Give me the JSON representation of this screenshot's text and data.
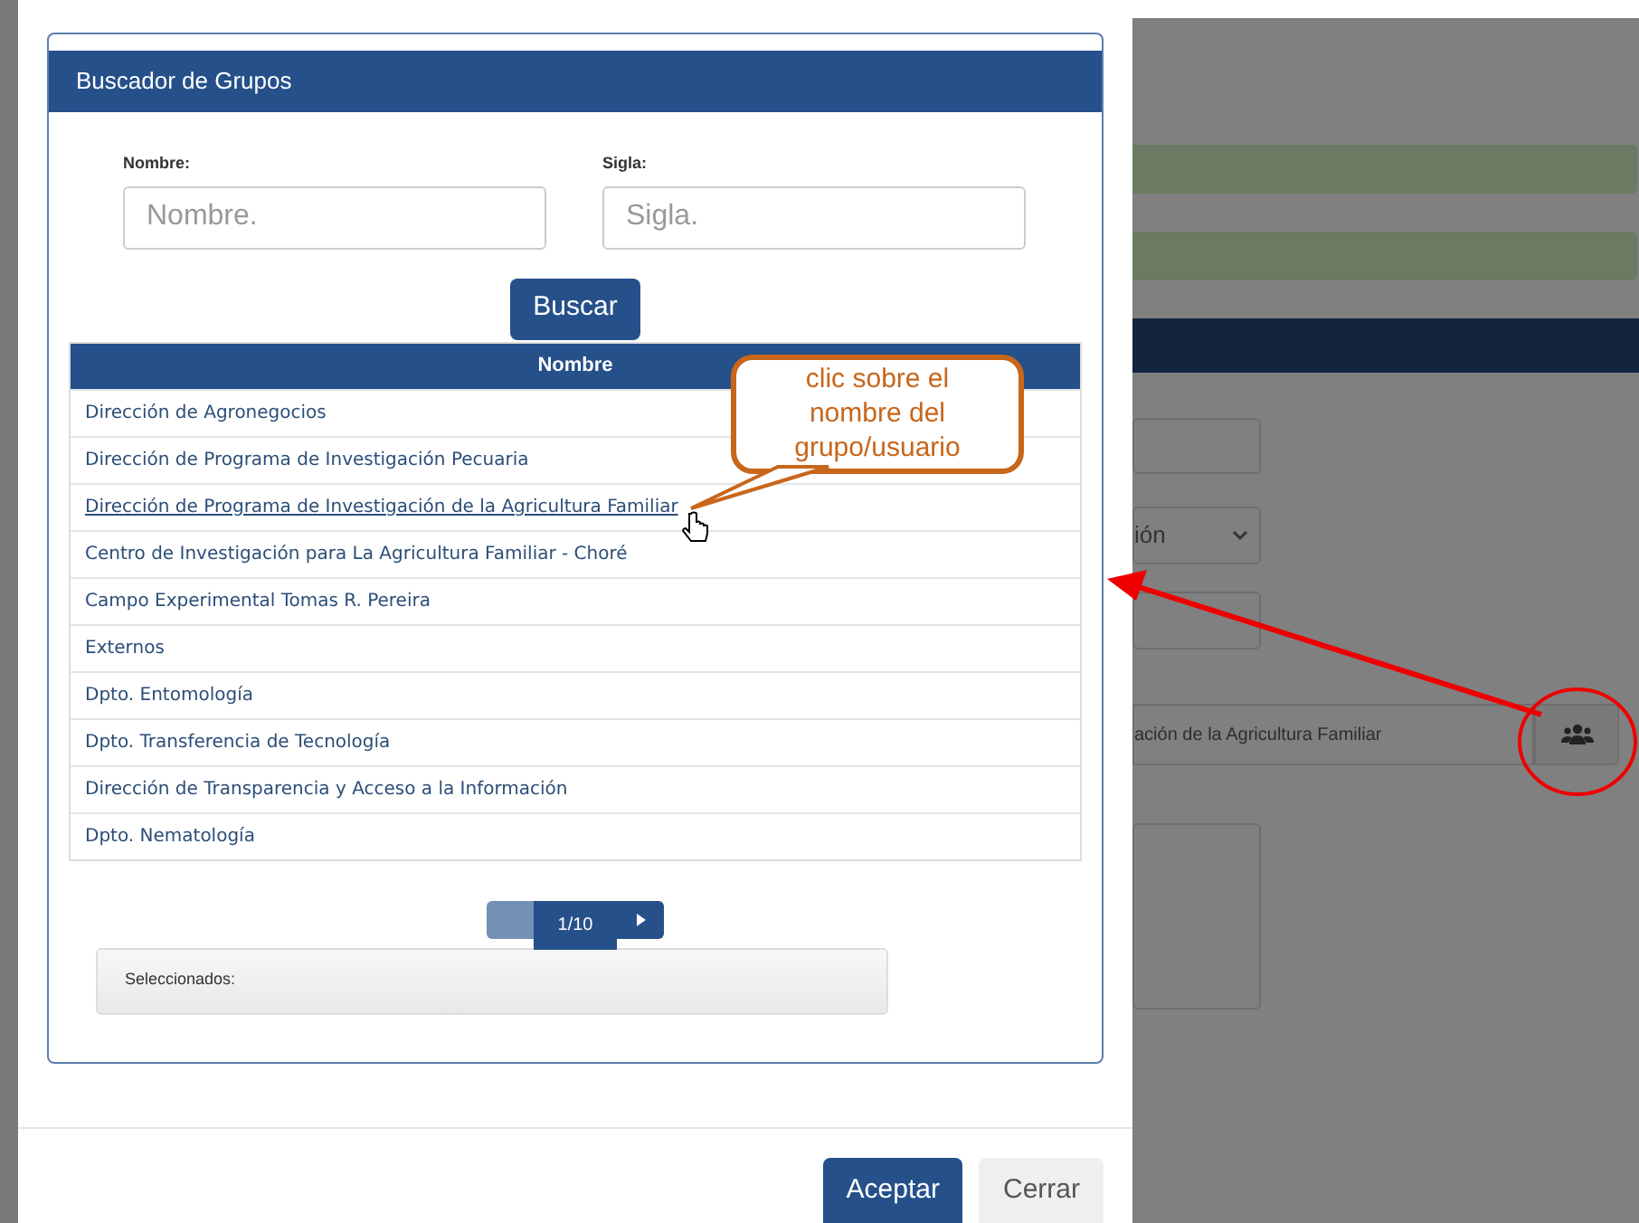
{
  "dialog": {
    "title": "Buscador de Grupos",
    "fields": [
      {
        "label": "Nombre:",
        "placeholder": "Nombre."
      },
      {
        "label": "Sigla:",
        "placeholder": "Sigla."
      }
    ],
    "search_button": "Buscar",
    "table": {
      "columns": [
        "Nombre"
      ],
      "rows": [
        {
          "name": "Dirección de Agronegocios",
          "hovered": false
        },
        {
          "name": "Dirección de Programa de Investigación Pecuaria",
          "hovered": false
        },
        {
          "name": "Dirección de Programa de Investigación de la Agricultura Familiar",
          "hovered": true
        },
        {
          "name": "Centro de Investigación para La Agricultura Familiar - Choré",
          "hovered": false
        },
        {
          "name": "Campo Experimental Tomas R. Pereira",
          "hovered": false
        },
        {
          "name": "Externos",
          "hovered": false
        },
        {
          "name": "Dpto. Entomología",
          "hovered": false
        },
        {
          "name": "Dpto. Transferencia de Tecnología",
          "hovered": false
        },
        {
          "name": "Dirección de Transparencia y Acceso a la Información",
          "hovered": false
        },
        {
          "name": "Dpto. Nematología",
          "hovered": false
        }
      ]
    },
    "pagination": {
      "page": "1/10",
      "prev_disabled": true,
      "next_disabled": false
    },
    "selected_label": "Seleccionados:",
    "buttons": [
      {
        "label": "Aceptar",
        "kind": "primary"
      },
      {
        "label": "Cerrar",
        "kind": "secondary"
      }
    ]
  },
  "callout": {
    "text": "clic sobre el nombre del grupo/usuario"
  },
  "background_form": {
    "select_text": "ión",
    "group_field_text": "ación de la Agricultura Familiar"
  }
}
